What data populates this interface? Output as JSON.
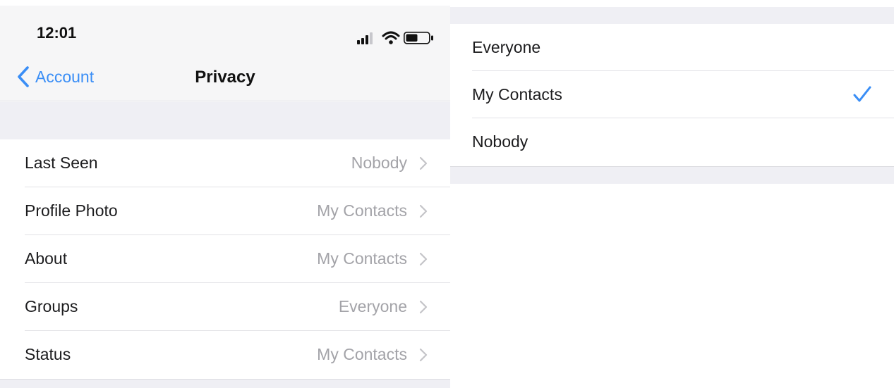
{
  "status_bar": {
    "time": "12:01",
    "icons": [
      "signal-icon",
      "wifi-icon",
      "battery-icon"
    ]
  },
  "nav": {
    "back_label": "Account",
    "title": "Privacy"
  },
  "privacy_settings": [
    {
      "label": "Last Seen",
      "value": "Nobody"
    },
    {
      "label": "Profile Photo",
      "value": "My Contacts"
    },
    {
      "label": "About",
      "value": "My Contacts"
    },
    {
      "label": "Groups",
      "value": "Everyone"
    },
    {
      "label": "Status",
      "value": "My Contacts"
    }
  ],
  "visibility_options": [
    {
      "label": "Everyone",
      "selected": false
    },
    {
      "label": "My Contacts",
      "selected": true
    },
    {
      "label": "Nobody",
      "selected": false
    }
  ],
  "colors": {
    "accent": "#3a8ef6",
    "secondary_text": "#a3a3a8",
    "grouped_background": "#efeff4",
    "bar_background": "#f6f6f7"
  }
}
